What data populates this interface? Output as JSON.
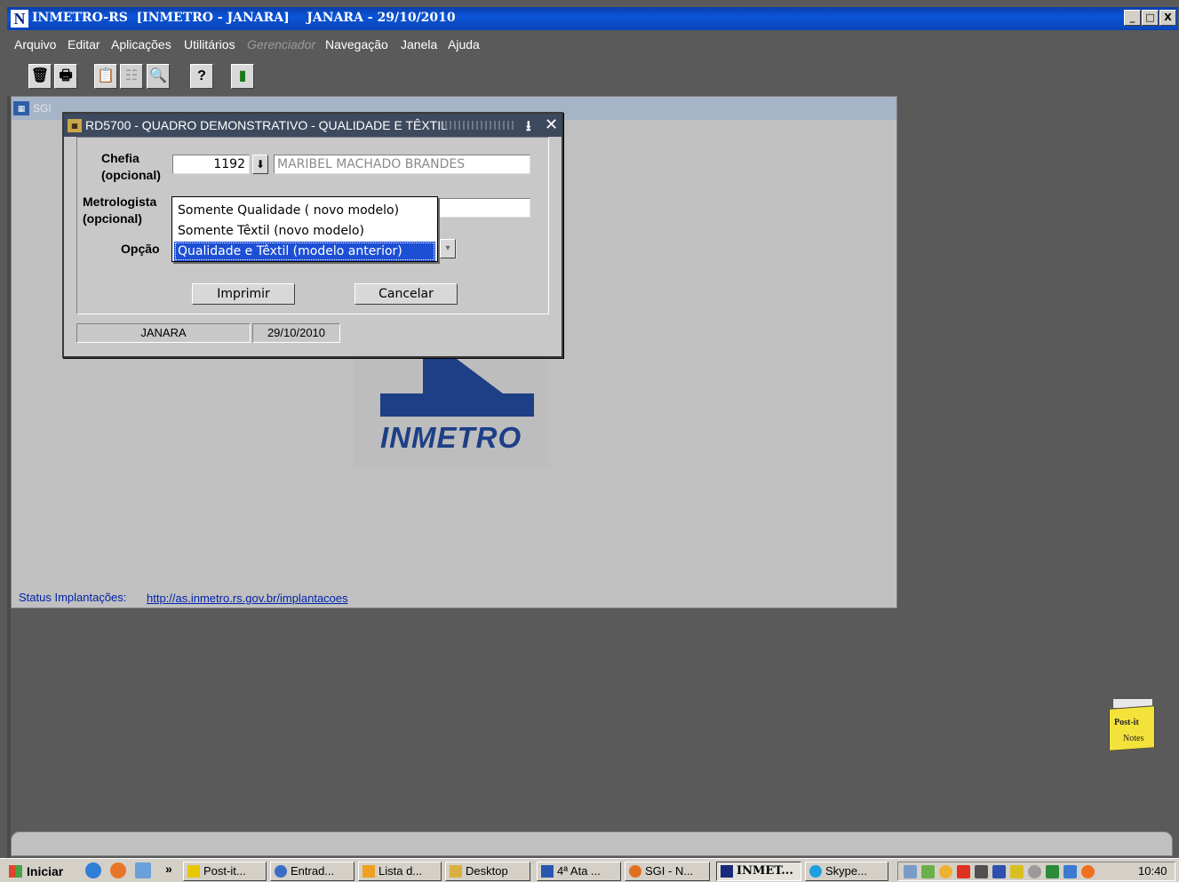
{
  "window": {
    "title": "INMETRO-RS  [INMETRO - JANARA]    JANARA - 29/10/2010",
    "app_glyph": "N",
    "controls": {
      "minimize": "_",
      "maximize": "□",
      "close": "X"
    }
  },
  "menu": [
    {
      "label": "Arquivo",
      "enabled": true
    },
    {
      "label": "Editar",
      "enabled": true
    },
    {
      "label": "Aplicações",
      "enabled": true
    },
    {
      "label": "Utilitários",
      "enabled": true
    },
    {
      "label": "Gerenciador",
      "enabled": false
    },
    {
      "label": "Navegação",
      "enabled": true
    },
    {
      "label": "Janela",
      "enabled": true
    },
    {
      "label": "Ajuda",
      "enabled": true
    }
  ],
  "toolbar": [
    {
      "icon": "trash-icon",
      "glyph": "🗑",
      "enabled": true
    },
    {
      "icon": "print-icon",
      "glyph": "🖶",
      "enabled": true
    },
    {
      "icon": "clipboard-icon",
      "glyph": "📋",
      "enabled": true
    },
    {
      "icon": "list-icon",
      "glyph": "☷",
      "enabled": false
    },
    {
      "icon": "search-icon",
      "glyph": "🔍",
      "enabled": false
    },
    {
      "icon": "help-icon",
      "glyph": "?",
      "enabled": true
    },
    {
      "icon": "exit-door-icon",
      "glyph": "▮",
      "enabled": true
    }
  ],
  "sgi_window": {
    "title": "SGI",
    "status_label": "Status Implantações:",
    "status_link": "http://as.inmetro.rs.gov.br/implantacoes",
    "logo_text": "INMETRO"
  },
  "dialog": {
    "title": "RD5700 - QUADRO DEMONSTRATIVO - QUALIDADE E TÊXTIL",
    "chefia_label": "Chefia",
    "chefia_sub": "(opcional)",
    "chefia_code": "1192",
    "chefia_name": "MARIBEL MACHADO BRANDES",
    "metrologista_label": "Metrologista",
    "metrologista_sub": "(opcional)",
    "opcao_label": "Opção",
    "print_button": "Imprimir",
    "cancel_button": "Cancelar",
    "status_user": "JANARA",
    "status_date": "29/10/2010",
    "options": [
      "Somente Qualidade ( novo modelo)",
      "Somente Têxtil (novo modelo)",
      "Qualidade e Têxtil (modelo anterior)"
    ],
    "selected_option_index": 2
  },
  "postit": {
    "line1": "Post-it",
    "line2": "Notes"
  },
  "taskbar": {
    "start_label": "Iniciar",
    "chevron": "»",
    "tasks": [
      {
        "label": "Post-it...",
        "color": "#e6c700"
      },
      {
        "label": "Entrad...",
        "color": "#3a6ec4"
      },
      {
        "label": "Lista d...",
        "color": "#f0a020"
      },
      {
        "label": "Desktop",
        "color": "#d8b040"
      },
      {
        "label": "4ª Ata ...",
        "color": "#2a56b0"
      },
      {
        "label": "SGI - N...",
        "color": "#e07020"
      },
      {
        "label": "INMET...",
        "color": "#1a2a7a",
        "active": true
      },
      {
        "label": "Skype...",
        "color": "#1ea0e0"
      }
    ],
    "clock": "10:40"
  }
}
